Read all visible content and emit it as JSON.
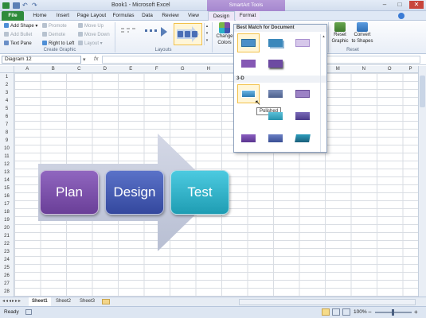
{
  "title_bar": {
    "title": "Book1 - Microsoft Excel",
    "context_tools": "SmartArt Tools",
    "minimize": "–",
    "maximize": "□",
    "close": "✕"
  },
  "tabs": [
    {
      "label": "File"
    },
    {
      "label": "Home"
    },
    {
      "label": "Insert"
    },
    {
      "label": "Page Layout"
    },
    {
      "label": "Formulas"
    },
    {
      "label": "Data"
    },
    {
      "label": "Review"
    },
    {
      "label": "View"
    },
    {
      "label": "Design"
    },
    {
      "label": "Format"
    }
  ],
  "ribbon": {
    "create_graphic": {
      "label": "Create Graphic",
      "add_shape": "Add Shape",
      "add_bullet": "Add Bullet",
      "text_pane": "Text Pane",
      "promote": "Promote",
      "demote": "Demote",
      "right_to_left": "Right to Left",
      "move_up": "Move Up",
      "move_down": "Move Down",
      "layout": "Layout"
    },
    "layouts": {
      "label": "Layouts"
    },
    "change_colors": {
      "line1": "Change",
      "line2": "Colors"
    },
    "reset": {
      "label": "Reset",
      "reset_graphic_1": "Reset",
      "reset_graphic_2": "Graphic",
      "convert_1": "Convert",
      "convert_2": "to Shapes"
    }
  },
  "name_box": "Diagram 12",
  "columns": [
    "A",
    "B",
    "C",
    "D",
    "E",
    "F",
    "G",
    "H",
    "I",
    "J",
    "K",
    "L",
    "M",
    "N",
    "O",
    "P"
  ],
  "rows": [
    "1",
    "2",
    "3",
    "4",
    "5",
    "6",
    "7",
    "8",
    "9",
    "10",
    "11",
    "12",
    "13",
    "14",
    "15",
    "16",
    "17",
    "18",
    "19",
    "20",
    "21",
    "22",
    "23",
    "24",
    "25",
    "26",
    "27",
    "28"
  ],
  "smartart": {
    "steps": [
      {
        "label": "Plan",
        "color": "#7b4fa8"
      },
      {
        "label": "Design",
        "color": "#3f57b0"
      },
      {
        "label": "Test",
        "color": "#2ab3c9"
      }
    ]
  },
  "style_gallery": {
    "section_best": "Best Match for Document",
    "section_3d": "3-D",
    "tooltip": "Polished"
  },
  "sheets": [
    "Sheet1",
    "Sheet2",
    "Sheet3"
  ],
  "status": {
    "ready": "Ready",
    "zoom": "100%",
    "zoom_out": "−",
    "zoom_in": "+"
  }
}
